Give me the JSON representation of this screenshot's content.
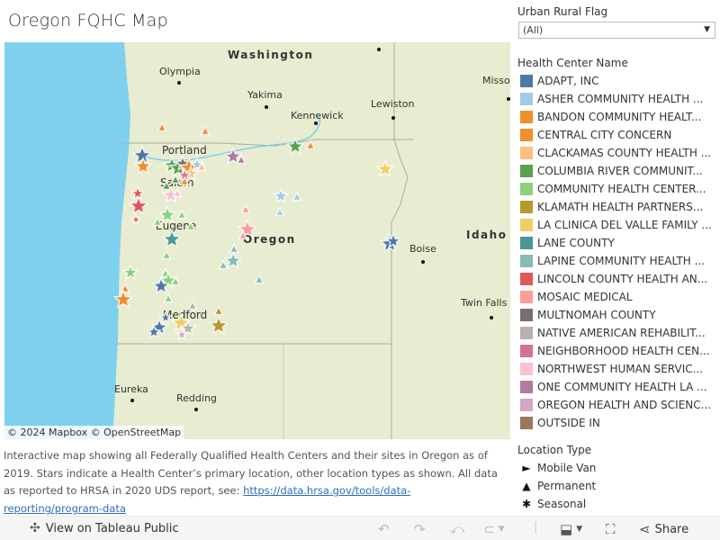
{
  "title": "Oregon FQHC Map",
  "filter": {
    "label": "Urban Rural Flag",
    "selected": "(All)"
  },
  "legend": {
    "title": "Health Center Name",
    "items": [
      {
        "label": "ADAPT, INC",
        "color": "#4e79a7"
      },
      {
        "label": "ASHER COMMUNITY HEALTH ...",
        "color": "#a0cbe8"
      },
      {
        "label": "BANDON COMMUNITY HEALT...",
        "color": "#f28e2b"
      },
      {
        "label": "CENTRAL CITY CONCERN",
        "color": "#f28e2b"
      },
      {
        "label": "CLACKAMAS COUNTY HEALTH ...",
        "color": "#ffbe7d"
      },
      {
        "label": "COLUMBIA RIVER COMMUNIT...",
        "color": "#59a14f"
      },
      {
        "label": "COMMUNITY HEALTH CENTER...",
        "color": "#8cd17d"
      },
      {
        "label": "KLAMATH HEALTH PARTNERS...",
        "color": "#b6992d"
      },
      {
        "label": "LA CLINICA DEL VALLE FAMILY ...",
        "color": "#f1ce63"
      },
      {
        "label": "LANE COUNTY",
        "color": "#499894"
      },
      {
        "label": "LAPINE COMMUNITY HEALTH ...",
        "color": "#86bcb6"
      },
      {
        "label": "LINCOLN COUNTY HEALTH AN...",
        "color": "#e15759"
      },
      {
        "label": "MOSAIC MEDICAL",
        "color": "#ff9d9a"
      },
      {
        "label": "MULTNOMAH COUNTY",
        "color": "#79706e"
      },
      {
        "label": "NATIVE AMERICAN REHABILIT...",
        "color": "#bab0ac"
      },
      {
        "label": "NEIGHBORHOOD HEALTH CEN...",
        "color": "#d37295"
      },
      {
        "label": "NORTHWEST HUMAN SERVIC...",
        "color": "#fabfd2"
      },
      {
        "label": "ONE COMMUNITY HEALTH LA ...",
        "color": "#b07aa1"
      },
      {
        "label": "OREGON HEALTH AND SCIENC...",
        "color": "#d4a6c8"
      },
      {
        "label": "OUTSIDE IN",
        "color": "#9d7660"
      }
    ]
  },
  "location_type": {
    "title": "Location Type",
    "items": [
      {
        "label": "Mobile Van",
        "glyph": "►",
        "icon": "play-triangle-icon"
      },
      {
        "label": "Permanent",
        "glyph": "▲",
        "icon": "triangle-icon"
      },
      {
        "label": "Seasonal",
        "glyph": "✱",
        "icon": "asterisk-icon"
      }
    ]
  },
  "map": {
    "cities": [
      {
        "name": "Olympia"
      },
      {
        "name": "Yakima"
      },
      {
        "name": "Kennewick"
      },
      {
        "name": "Lewiston"
      },
      {
        "name": "Portland"
      },
      {
        "name": "Salem"
      },
      {
        "name": "Eugene"
      },
      {
        "name": "Medford"
      },
      {
        "name": "Boise"
      },
      {
        "name": "Twin Falls"
      },
      {
        "name": "Eureka"
      },
      {
        "name": "Redding"
      },
      {
        "name": "Misso"
      }
    ],
    "states": [
      "Washington",
      "Oregon",
      "Idaho"
    ],
    "attribution": "© 2024 Mapbox  © OpenStreetMap"
  },
  "description": {
    "text": "Interactive map showing all Federally Qualified Health Centers and their sites in Oregon as of 2019. Stars indicate a Health Center’s primary location, other location types as shown. All data as reported to HRSA in 2020 UDS report, see: ",
    "link": "https://data.hrsa.gov/tools/data-reporting/program-data"
  },
  "toolbar": {
    "view_label": "View on Tableau Public",
    "share_label": "Share"
  }
}
